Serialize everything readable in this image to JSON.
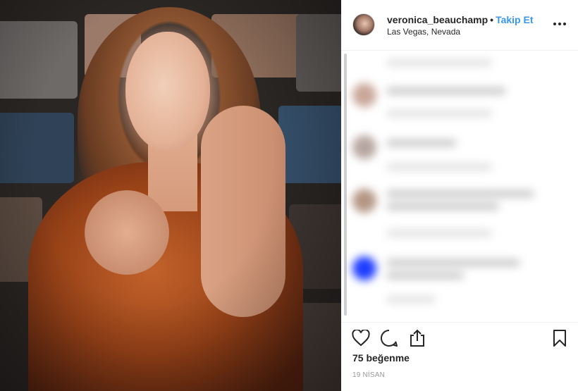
{
  "post": {
    "author": {
      "username": "veronica_beauchamp",
      "separator": "•",
      "follow_label": "Takip Et",
      "location": "Las Vegas, Nevada"
    },
    "likes_label": "75 beğenme",
    "date_label": "19 NİSAN"
  },
  "icons": {
    "more": "more-options-icon",
    "like": "heart-icon",
    "comment": "comment-icon",
    "share": "share-icon",
    "save": "bookmark-icon"
  },
  "colors": {
    "accent": "#3897f0",
    "text": "#262626",
    "muted": "#999999"
  }
}
